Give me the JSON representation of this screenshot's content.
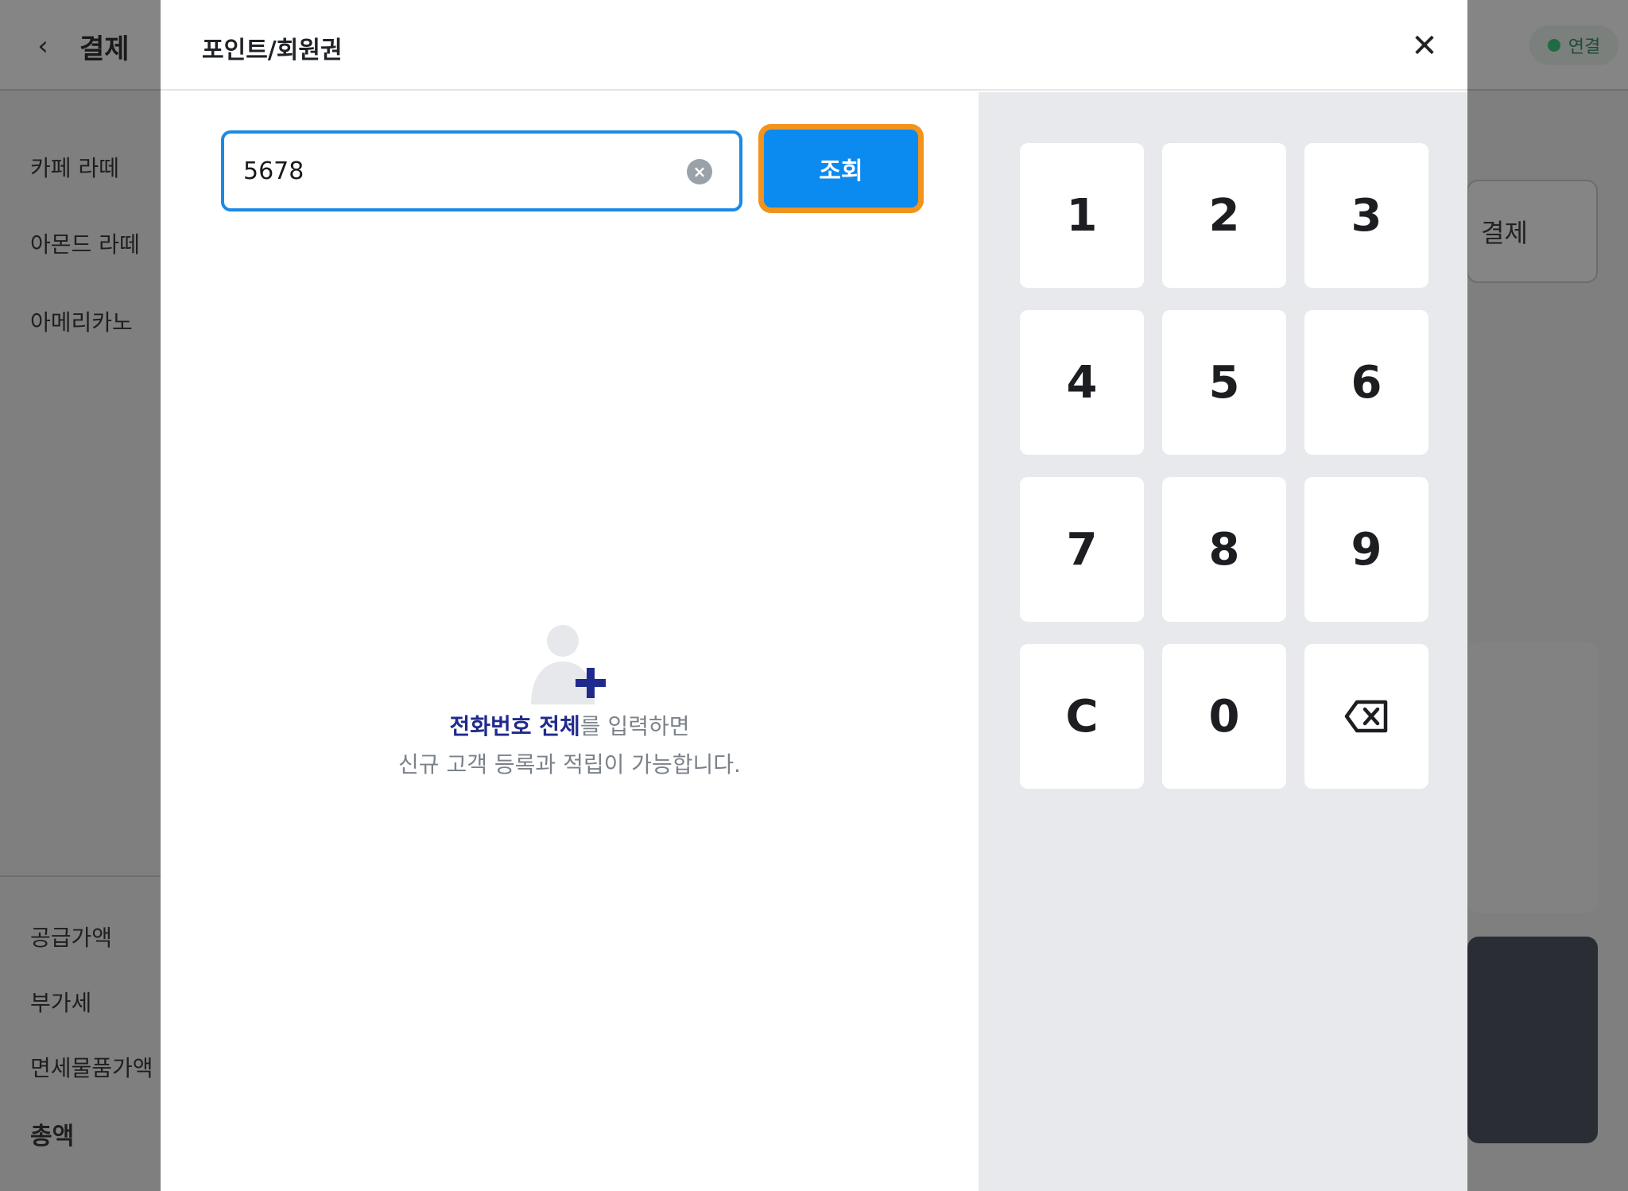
{
  "background": {
    "title": "결제",
    "status": "연결",
    "menu_items": [
      "카페 라떼",
      "아몬드 라떼",
      "아메리카노"
    ],
    "summary": [
      "공급가액",
      "부가세",
      "면세물품가액",
      "총액"
    ],
    "right_button_label": "결제"
  },
  "modal": {
    "title": "포인트/회원권",
    "search": {
      "value": "5678"
    },
    "lookup_label": "조회",
    "hint": {
      "strong": "전화번호 전체",
      "rest": "를 입력하면",
      "line2": "신규 고객 등록과 적립이 가능합니다."
    },
    "keypad": [
      "1",
      "2",
      "3",
      "4",
      "5",
      "6",
      "7",
      "8",
      "9",
      "C",
      "0",
      "backspace-icon"
    ]
  }
}
